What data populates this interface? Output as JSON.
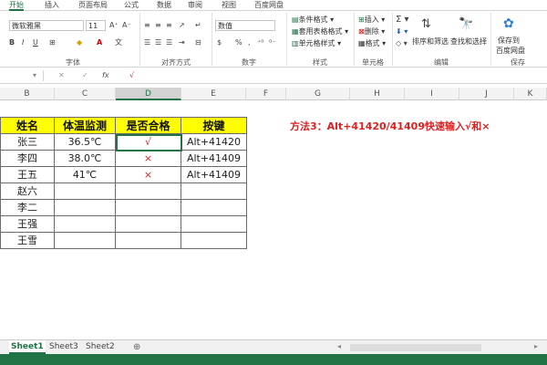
{
  "menu": {
    "tabs": [
      "开始",
      "插入",
      "页面布局",
      "公式",
      "数据",
      "审阅",
      "视图",
      "百度网盘"
    ]
  },
  "ribbon": {
    "font_name": "微软雅黑",
    "font_size": "11",
    "number_format": "数值",
    "styles": {
      "conditional": "条件格式",
      "table": "套用表格格式",
      "cell": "单元格样式"
    },
    "cells": {
      "insert": "插入",
      "delete": "删除",
      "format": "格式"
    },
    "editing": {
      "sort": "排序和筛选",
      "find": "查找和选择"
    },
    "save": {
      "line1": "保存到",
      "line2": "百度网盘"
    },
    "groups": {
      "font": "字体",
      "align": "对齐方式",
      "number": "数字",
      "styles": "样式",
      "cells": "单元格",
      "editing": "编辑",
      "save": "保存"
    }
  },
  "formula": {
    "value": "√"
  },
  "columns": [
    "B",
    "C",
    "D",
    "E",
    "F",
    "G",
    "H",
    "I",
    "J",
    "K"
  ],
  "table": {
    "headers": [
      "姓名",
      "体温监测",
      "是否合格",
      "按键"
    ],
    "rows": [
      [
        "张三",
        "36.5℃",
        "√",
        "Alt+41420"
      ],
      [
        "李四",
        "38.0℃",
        "×",
        "Alt+41409"
      ],
      [
        "王五",
        "41℃",
        "×",
        "Alt+41409"
      ],
      [
        "赵六",
        "",
        "",
        ""
      ],
      [
        "李二",
        "",
        "",
        ""
      ],
      [
        "王强",
        "",
        "",
        ""
      ],
      [
        "王雪",
        "",
        "",
        ""
      ]
    ]
  },
  "note": "方法3：Alt+41420/41409快速输入√和×",
  "sheets": [
    "Sheet1",
    "Sheet3",
    "Sheet2"
  ],
  "colors": {
    "accent": "#217346",
    "header_fill": "#ffff00",
    "note": "#e02020"
  }
}
